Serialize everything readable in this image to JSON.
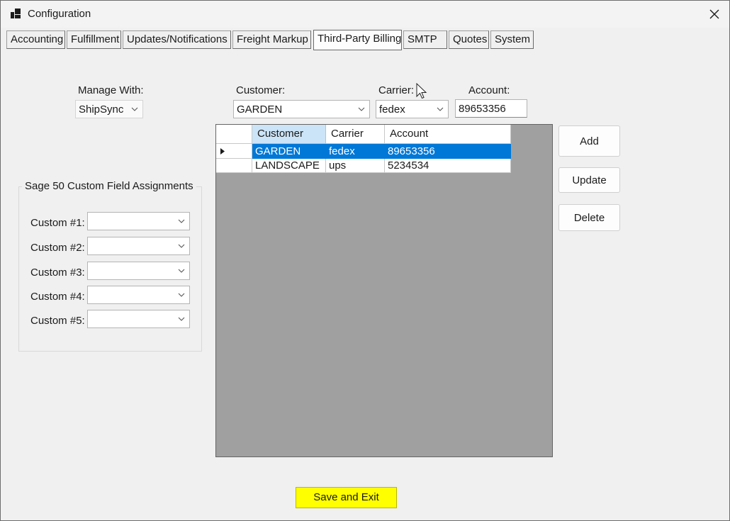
{
  "window": {
    "title": "Configuration",
    "app_icon": "app-window-icon",
    "close_icon": "close-icon"
  },
  "tabs": [
    {
      "label": "Accounting"
    },
    {
      "label": "Fulfillment"
    },
    {
      "label": "Updates/Notifications"
    },
    {
      "label": "Freight Markup"
    },
    {
      "label": "Third-Party Billing",
      "active": true
    },
    {
      "label": "SMTP"
    },
    {
      "label": "Quotes"
    },
    {
      "label": "System"
    }
  ],
  "manage_with": {
    "label": "Manage With:",
    "value": "ShipSync"
  },
  "customer": {
    "label": "Customer:",
    "value": "GARDEN"
  },
  "carrier": {
    "label": "Carrier:",
    "value": "fedex"
  },
  "account": {
    "label": "Account:",
    "value": "89653356"
  },
  "custom_fields": {
    "title": "Sage 50 Custom Field Assignments",
    "items": [
      {
        "label": "Custom #1:",
        "value": ""
      },
      {
        "label": "Custom #2:",
        "value": ""
      },
      {
        "label": "Custom #3:",
        "value": ""
      },
      {
        "label": "Custom #4:",
        "value": ""
      },
      {
        "label": "Custom #5:",
        "value": ""
      }
    ]
  },
  "grid": {
    "columns": [
      "Customer",
      "Carrier",
      "Account"
    ],
    "rows": [
      {
        "customer": "GARDEN",
        "carrier": "fedex",
        "account": "89653356",
        "selected": true
      },
      {
        "customer": "LANDSCAPE",
        "carrier": "ups",
        "account": "5234534",
        "selected": false
      }
    ],
    "row_indicator_icon": "row-pointer-icon"
  },
  "actions": {
    "add": "Add",
    "update": "Update",
    "delete": "Delete",
    "save_exit": "Save and Exit"
  },
  "colors": {
    "selection": "#0078d7",
    "header_selected": "#cce4f7",
    "save_button": "#ffff00",
    "grid_background": "#a0a0a0"
  }
}
